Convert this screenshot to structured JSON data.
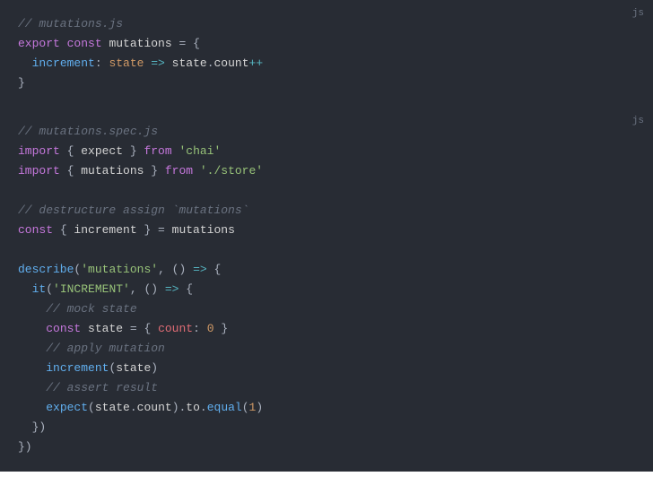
{
  "block1": {
    "lang": "js",
    "lines": {
      "c1": "// mutations.js",
      "l2_export": "export",
      "l2_const": "const",
      "l2_mutations": "mutations",
      "l2_eq": " = {",
      "l3_increment": "increment",
      "l3_colon": ": ",
      "l3_state": "state",
      "l3_arrow": " => ",
      "l3_state2": "state",
      "l3_dot": ".",
      "l3_count": "count",
      "l3_pp": "++",
      "l4": "}"
    }
  },
  "block2": {
    "lang": "js",
    "lines": {
      "c1": "// mutations.spec.js",
      "l2_import": "import",
      "l2_b1": " { ",
      "l2_expect": "expect",
      "l2_b2": " } ",
      "l2_from": "from",
      "l2_chai": "'chai'",
      "l3_import": "import",
      "l3_b1": " { ",
      "l3_mutations": "mutations",
      "l3_b2": " } ",
      "l3_from": "from",
      "l3_store": "'./store'",
      "c2": "// destructure assign `mutations`",
      "l5_const": "const",
      "l5_b1": " { ",
      "l5_increment": "increment",
      "l5_b2": " } = ",
      "l5_mutations": "mutations",
      "l7_describe": "describe",
      "l7_p1": "(",
      "l7_str": "'mutations'",
      "l7_comma": ", () ",
      "l7_arrow": "=>",
      "l7_b": " {",
      "l8_it": "it",
      "l8_p1": "(",
      "l8_str": "'INCREMENT'",
      "l8_comma": ", () ",
      "l8_arrow": "=>",
      "l8_b": " {",
      "c3": "// mock state",
      "l10_const": "const",
      "l10_state": "state",
      "l10_eq": " = { ",
      "l10_count": "count",
      "l10_colon": ": ",
      "l10_zero": "0",
      "l10_b": " }",
      "c4": "// apply mutation",
      "l12_increment": "increment",
      "l12_p1": "(",
      "l12_state": "state",
      "l12_p2": ")",
      "c5": "// assert result",
      "l14_expect": "expect",
      "l14_p1": "(",
      "l14_state": "state",
      "l14_dot1": ".",
      "l14_count": "count",
      "l14_p2": ").",
      "l14_to": "to",
      "l14_dot2": ".",
      "l14_equal": "equal",
      "l14_p3": "(",
      "l14_one": "1",
      "l14_p4": ")",
      "l15": "  })",
      "l16": "})"
    }
  }
}
